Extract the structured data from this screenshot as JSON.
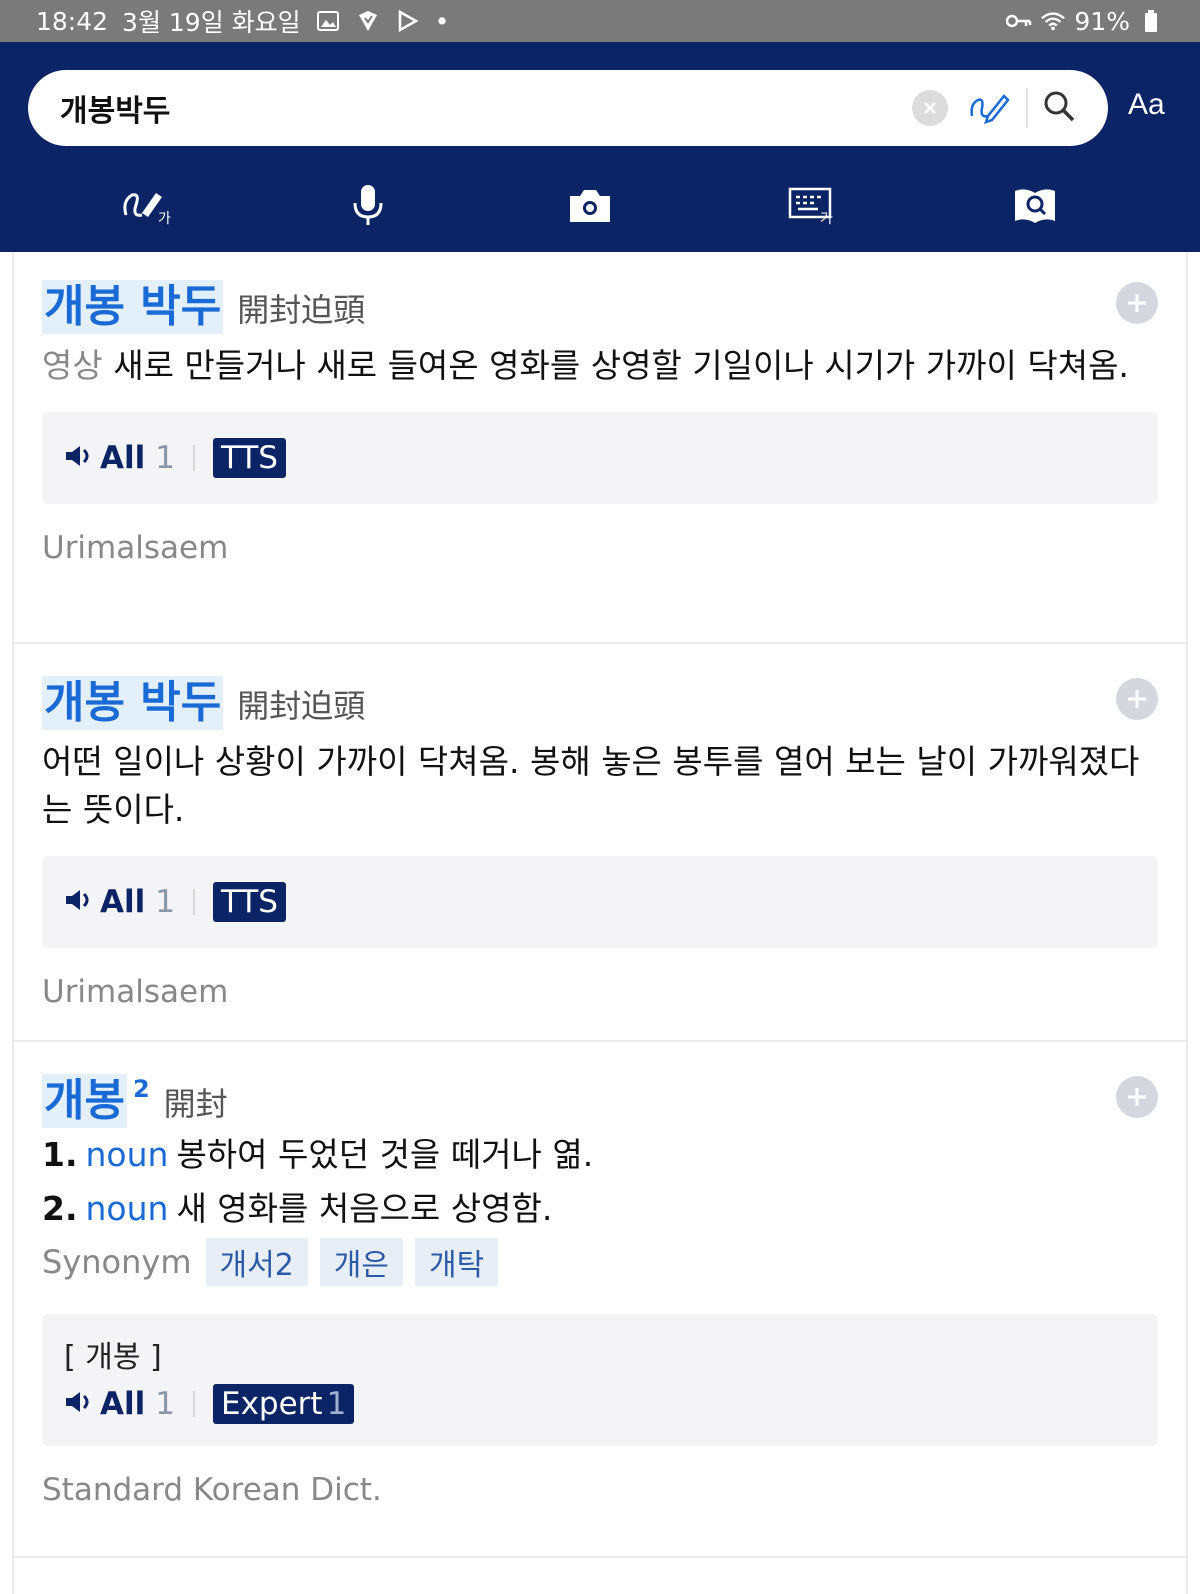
{
  "status_bar": {
    "time": "18:42",
    "date": "3월 19일 화요일",
    "dot": "•",
    "battery": "91%"
  },
  "search": {
    "query": "개봉박두",
    "font_button": "Aa"
  },
  "toolbar": {
    "items": [
      "handwriting-icon",
      "microphone-icon",
      "camera-icon",
      "keyboard-icon",
      "dictionary-search-icon"
    ]
  },
  "entries": [
    {
      "headword": "개봉 박두",
      "hanja": "開封迫頭",
      "definition_tag": "영상",
      "definition": " 새로 만들거나 새로 들여온 영화를 상영할 기일이나 시기가 가까이 닥쳐옴.",
      "audio": {
        "label": "All",
        "count": "1",
        "tag": "TTS"
      },
      "source": "Urimalsaem"
    },
    {
      "headword": "개봉 박두",
      "hanja": "開封迫頭",
      "definition": "어떤 일이나 상황이 가까이 닥쳐옴. 봉해 놓은 봉투를 열어 보는 날이 가까워졌다는 뜻이다.",
      "audio": {
        "label": "All",
        "count": "1",
        "tag": "TTS"
      },
      "source": "Urimalsaem"
    },
    {
      "headword": "개봉",
      "superscript": "2",
      "hanja": "開封",
      "senses": [
        {
          "num": "1.",
          "pos": "noun",
          "text": "봉하여 두었던 것을 떼거나 엶."
        },
        {
          "num": "2.",
          "pos": "noun",
          "text": "새 영화를 처음으로 상영함."
        }
      ],
      "synonym_label": "Synonym",
      "synonyms": [
        "개서2",
        "개은",
        "개탁"
      ],
      "pronunciation": "[ 개봉 ]",
      "audio": {
        "label": "All",
        "count": "1",
        "tag": "Expert",
        "tag_count": "1"
      },
      "source": "Standard Korean Dict."
    }
  ],
  "colors": {
    "header_bg": "#0a2465",
    "accent_blue": "#1a6ad6",
    "highlight_bg": "#e3f0fc",
    "chip_bg": "#0a2465"
  }
}
